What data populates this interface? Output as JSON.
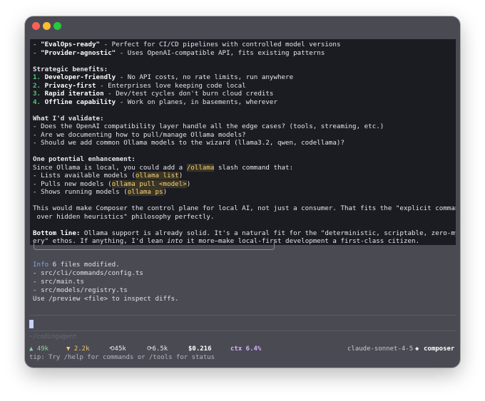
{
  "window": {
    "controls": [
      "close",
      "minimize",
      "zoom"
    ]
  },
  "response": {
    "line1": {
      "bullet": "- ",
      "strong": "\"EvalOps-ready\"",
      "rest": " - Perfect for CI/CD pipelines with controlled model versions"
    },
    "line2": {
      "bullet": "- ",
      "strong": "\"Provider-agnostic\"",
      "rest": " - Uses OpenAI-compatible API, fits existing patterns"
    },
    "strategic_heading": "Strategic benefits:",
    "benefits": [
      {
        "num": "1.",
        "strong": "Developer-friendly",
        "rest": " - No API costs, no rate limits, run anywhere"
      },
      {
        "num": "2.",
        "strong": "Privacy-first",
        "rest": " - Enterprises love keeping code local"
      },
      {
        "num": "3.",
        "strong": "Rapid iteration",
        "rest": " - Dev/test cycles don't burn cloud credits"
      },
      {
        "num": "4.",
        "strong": "Offline capability",
        "rest": " - Work on planes, in basements, wherever"
      }
    ],
    "validate_heading": "What I'd validate:",
    "validate": [
      "- Does the OpenAI compatibility layer handle all the edge cases? (tools, streaming, etc.)",
      "- Are we documenting how to pull/manage Ollama models?",
      "- Should we add common Ollama models to the wizard (llama3.2, qwen, codellama)?"
    ],
    "enhancement_heading": "One potential enhancement:",
    "enhancement_intro_a": "Since Ollama is local, you could add a ",
    "enhancement_cmd": "/ollama",
    "enhancement_intro_b": " slash command that:",
    "enh_items": [
      {
        "pre": "- Lists available models (",
        "code": "ollama list",
        "post": ")"
      },
      {
        "pre": "- Pulls new models (",
        "code": "ollama pull <model>",
        "post": ")"
      },
      {
        "pre": "- Shows running models (",
        "code": "ollama ps",
        "post": ")"
      }
    ],
    "para1": "This would make Composer the control plane for local AI, not just a consumer. That fits the \"explicit commands",
    "para1b": " over hidden heuristics\" philosophy perfectly.",
    "bottom_label": "Bottom line:",
    "bottom_a": " Ollama support is already solid. It's a natural fit for the \"deterministic, scriptable, zero-myst",
    "bottom_b1": "ery\" ethos. If anything, I'd lean ",
    "bottom_b_it": "into",
    "bottom_b2": " it more—make local-first development a first-class citizen."
  },
  "output": {
    "info_label": "Info",
    "info_text": " 6 files modified.",
    "files": [
      "- src/cli/commands/config.ts",
      "- src/main.ts",
      "- src/models/registry.ts"
    ],
    "hint": "Use /preview <file> to inspect diffs."
  },
  "prompt": {
    "placeholder": "~/codingagent"
  },
  "status": {
    "tokens_up": "▲ 49k",
    "tokens_down": "▼ 2.2k",
    "cache_read": "⟲45k",
    "cache_write": "⟳6.5k",
    "cost": "$0.216",
    "ctx": "ctx 6.4%",
    "model": "claude-sonnet-4-5",
    "separator": "◆",
    "persona": "composer"
  },
  "tip": "tip: Try /help for commands or /tools for status"
}
